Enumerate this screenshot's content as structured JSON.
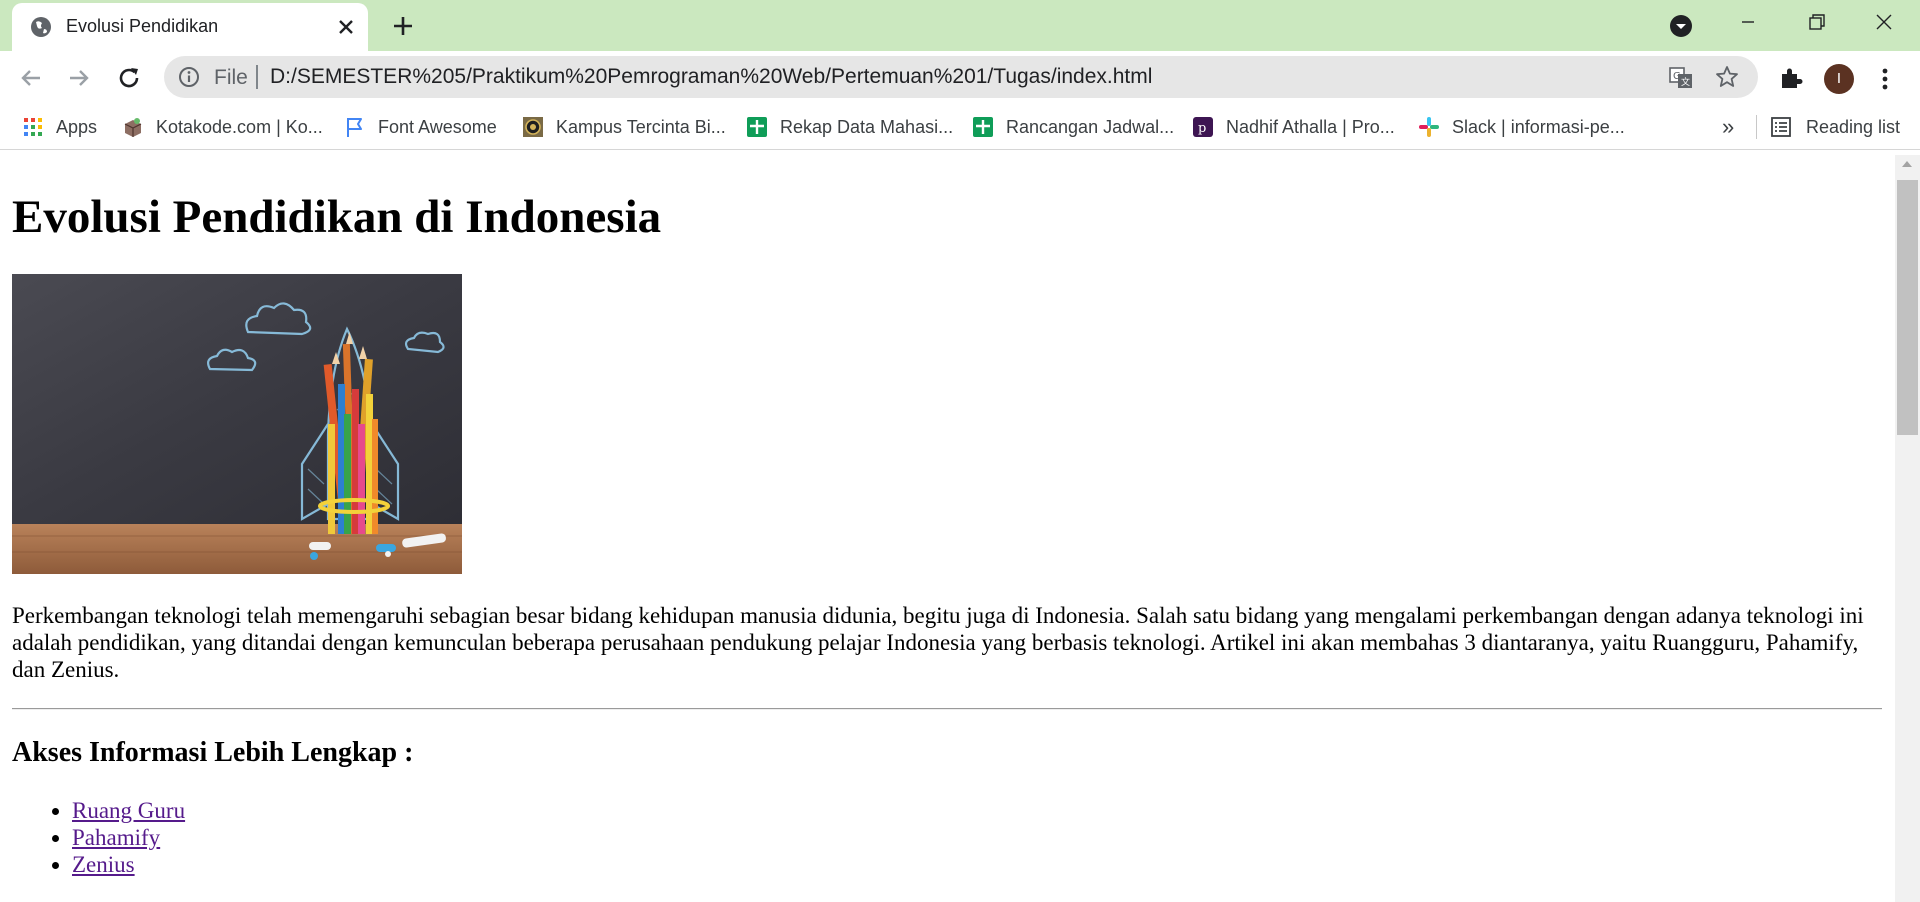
{
  "browser": {
    "tab": {
      "title": "Evolusi Pendidikan"
    },
    "address_bar": {
      "file_label": "File",
      "url": "D:/SEMESTER%205/Praktikum%20Pemrograman%20Web/Pertemuan%201/Tugas/index.html"
    },
    "profile_initial": "I",
    "bookmarks": [
      {
        "label": "Apps",
        "icon": "apps-grid-icon"
      },
      {
        "label": "Kotakode.com | Ko...",
        "icon": "kotakode-favicon"
      },
      {
        "label": "Font Awesome",
        "icon": "flag-icon"
      },
      {
        "label": "Kampus Tercinta Bi...",
        "icon": "campus-favicon"
      },
      {
        "label": "Rekap Data Mahasi...",
        "icon": "sheets-icon"
      },
      {
        "label": "Rancangan Jadwal...",
        "icon": "sheets-icon"
      },
      {
        "label": "Nadhif Athalla | Pro...",
        "icon": "profile-favicon"
      },
      {
        "label": "Slack | informasi-pe...",
        "icon": "slack-icon"
      }
    ],
    "more_bookmarks": "»",
    "reading_list": "Reading list"
  },
  "page": {
    "heading": "Evolusi Pendidikan di Indonesia",
    "hero_image": "chalkboard-rocket-pencils-image",
    "intro": "Perkembangan teknologi telah memengaruhi sebagian besar bidang kehidupan manusia didunia, begitu juga di Indonesia. Salah satu bidang yang mengalami perkembangan dengan adanya teknologi ini adalah pendidikan, yang ditandai dengan kemunculan beberapa perusahaan pendukung pelajar Indonesia yang berbasis teknologi. Artikel ini akan membahas 3 diantaranya, yaitu Ruangguru, Pahamify, dan Zenius.",
    "subheading": "Akses Informasi Lebih Lengkap :",
    "links": [
      "Ruang Guru",
      "Pahamify",
      "Zenius"
    ]
  },
  "colors": {
    "tabstrip": "#cbe8bf",
    "link_visited": "#551a8b",
    "avatar": "#5b3222"
  }
}
